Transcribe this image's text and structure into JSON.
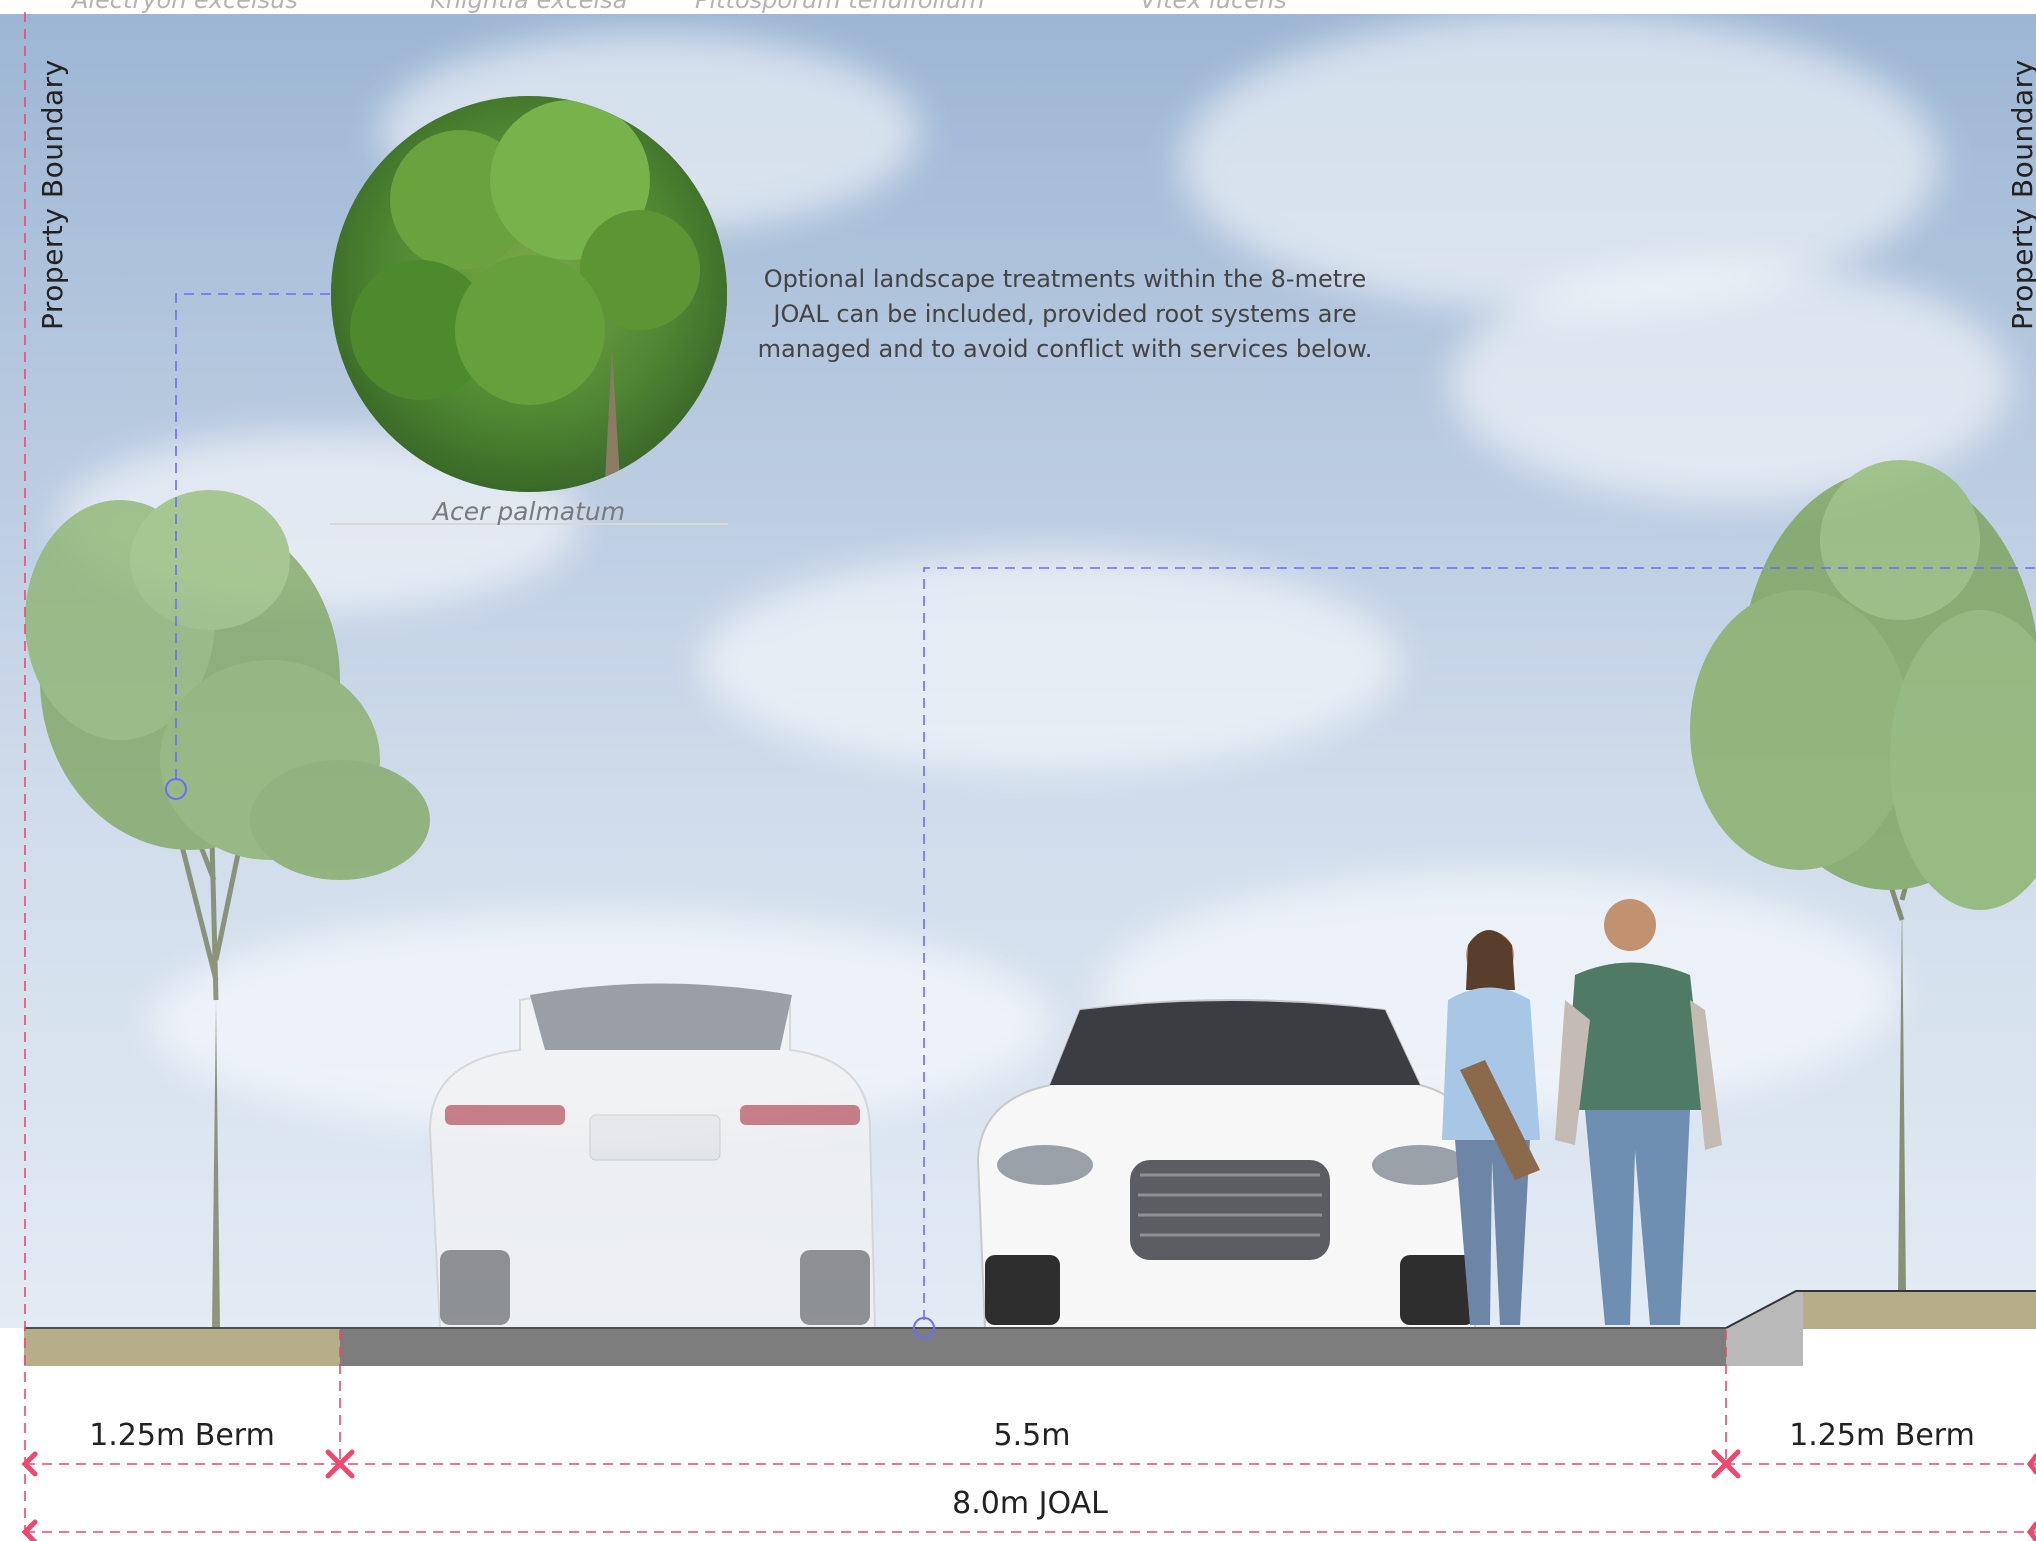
{
  "top_species": [
    "Alectryon excelsus",
    "Knightia excelsa",
    "Pittosporum tenuifolium",
    "Vitex lucens"
  ],
  "property_boundary_left": "Property Boundary",
  "property_boundary_right": "Property Boundary",
  "callout_text": "Optional landscape treatments within the 8-metre JOAL can be included, provided root systems are managed and to avoid conflict with services below.",
  "tree_caption": "Acer palmatum",
  "dimensions": {
    "left_berm": "1.25m Berm",
    "carriageway": "5.5m",
    "right_berm": "1.25m Berm",
    "total": "8.0m JOAL"
  },
  "colors": {
    "dimension_line": "#f0476f",
    "leader_line": "#6b6bff",
    "berm": "#b6ad89",
    "road": "#7d7d7d",
    "kerb": "#b9b9b9"
  }
}
